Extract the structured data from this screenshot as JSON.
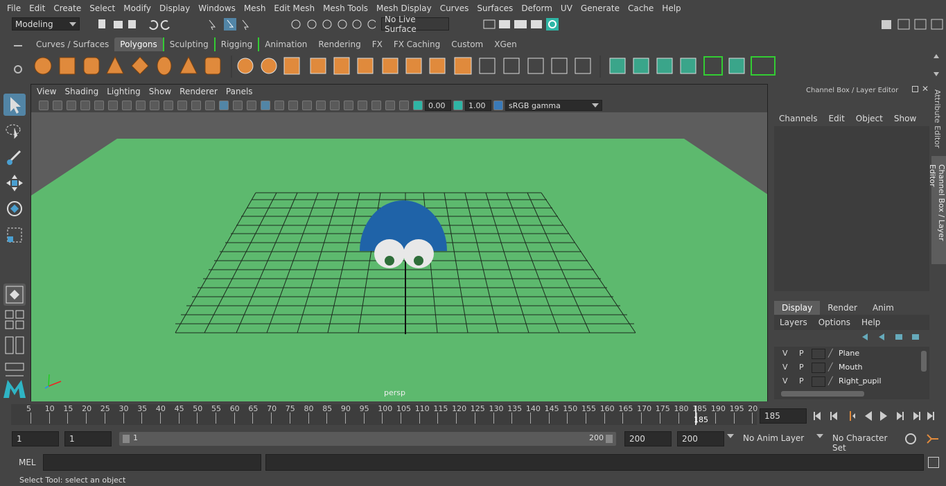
{
  "menus": [
    "File",
    "Edit",
    "Create",
    "Select",
    "Modify",
    "Display",
    "Windows",
    "Mesh",
    "Edit Mesh",
    "Mesh Tools",
    "Mesh Display",
    "Curves",
    "Surfaces",
    "Deform",
    "UV",
    "Generate",
    "Cache",
    "Help"
  ],
  "status": {
    "mode": "Modeling",
    "live_surface": "No Live Surface"
  },
  "shelf_tabs": [
    "Curves / Surfaces",
    "Polygons",
    "Sculpting",
    "Rigging",
    "Animation",
    "Rendering",
    "FX",
    "FX Caching",
    "Custom",
    "XGen"
  ],
  "viewport": {
    "menus": [
      "View",
      "Shading",
      "Lighting",
      "Show",
      "Renderer",
      "Panels"
    ],
    "exposure": "0.00",
    "gamma": "1.00",
    "color_space": "sRGB gamma",
    "camera_label": "persp",
    "colors": {
      "ground": "#5db96e",
      "body": "#1f63a8",
      "eye": "#e8e8e8",
      "pupil": "#2f6e3a"
    }
  },
  "channel_box": {
    "title": "Channel Box / Layer Editor",
    "menus": [
      "Channels",
      "Edit",
      "Object",
      "Show"
    ],
    "layer_tabs": [
      "Display",
      "Render",
      "Anim"
    ],
    "layer_menus": [
      "Layers",
      "Options",
      "Help"
    ],
    "layers": [
      {
        "v": "V",
        "p": "P",
        "name": "Plane"
      },
      {
        "v": "V",
        "p": "P",
        "name": "Mouth"
      },
      {
        "v": "V",
        "p": "P",
        "name": "Right_pupil"
      }
    ]
  },
  "side_tabs": {
    "attr": "Attribute Editor",
    "cb": "Channel Box / Layer Editor"
  },
  "timeline": {
    "ticks": [
      "5",
      "10",
      "15",
      "20",
      "25",
      "30",
      "35",
      "40",
      "45",
      "50",
      "55",
      "60",
      "65",
      "70",
      "75",
      "80",
      "85",
      "90",
      "95",
      "100",
      "105",
      "110",
      "115",
      "120",
      "125",
      "130",
      "135",
      "140",
      "145",
      "150",
      "155",
      "160",
      "165",
      "170",
      "175",
      "180",
      "185",
      "190",
      "195",
      "20"
    ],
    "current": "185",
    "current_field": "185"
  },
  "range": {
    "start": "1",
    "start2": "1",
    "slider_start": "1",
    "slider_end": "200",
    "end": "200",
    "end2": "200",
    "anim_layer": "No Anim Layer",
    "char_set": "No Character Set"
  },
  "cmd": {
    "label": "MEL"
  },
  "help": "Select Tool: select an object"
}
